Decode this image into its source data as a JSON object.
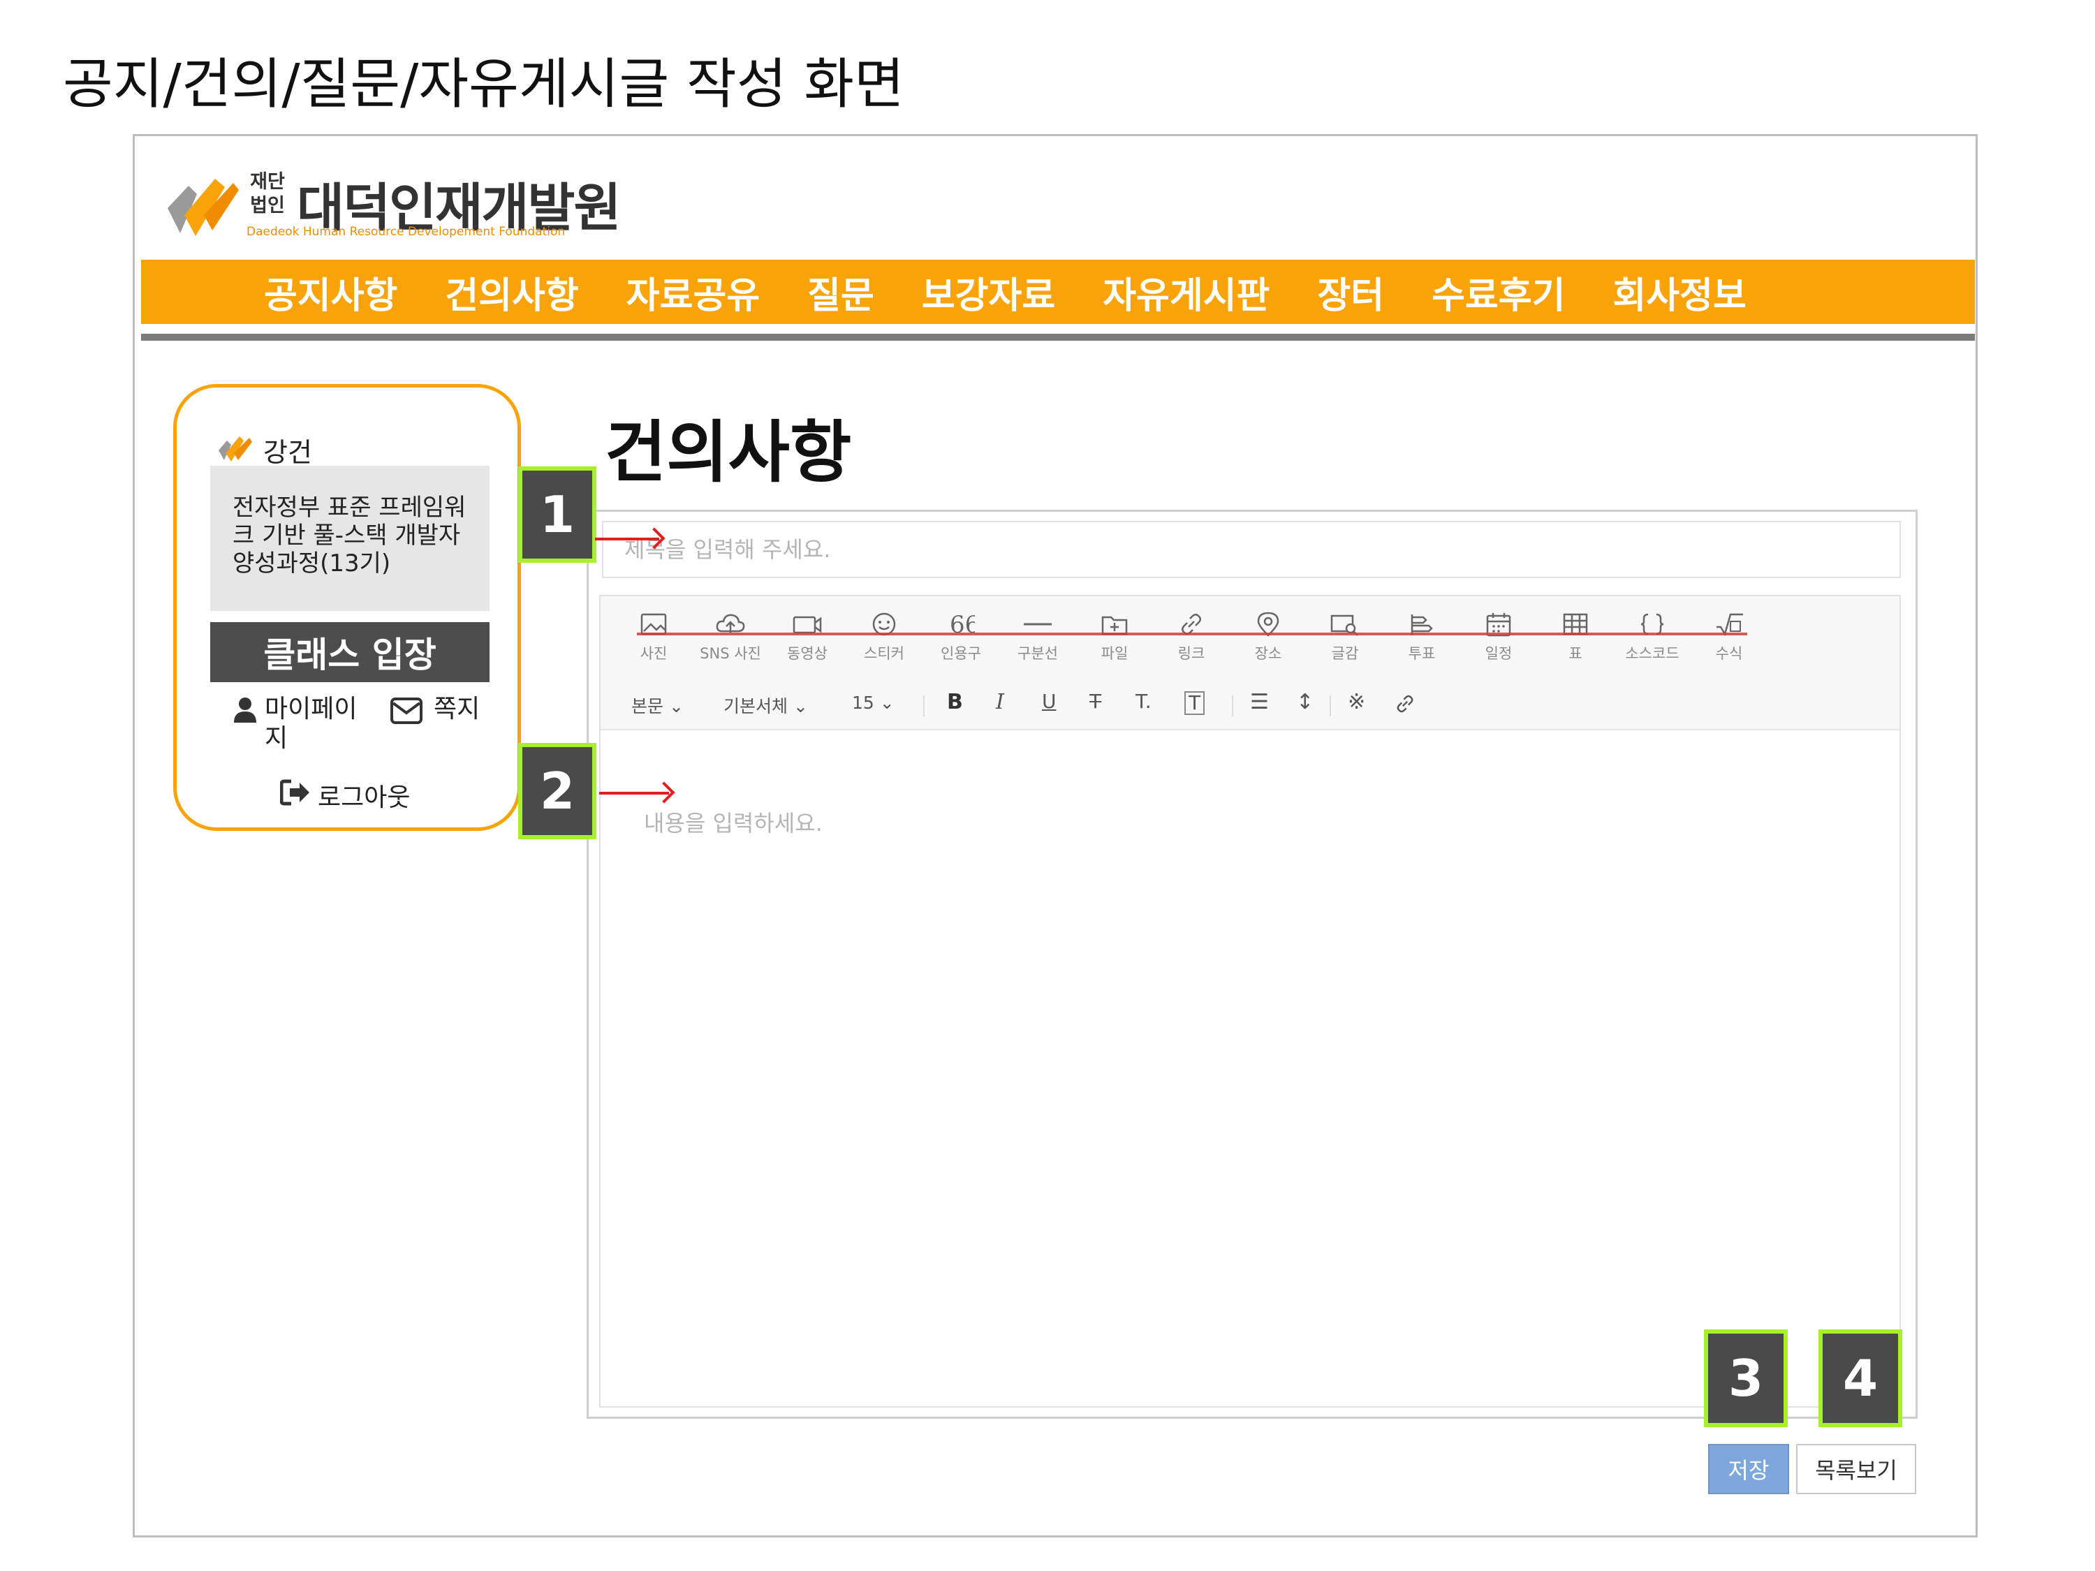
{
  "doc_title": "공지/건의/질문/자유게시글 작성 화면",
  "brand": {
    "corp_label": "재단법인",
    "name": "대덕인재개발원",
    "subtitle": "Daedeok Human Resource Developement Foundation"
  },
  "nav": [
    "공지사항",
    "건의사항",
    "자료공유",
    "질문",
    "보강자료",
    "자유게시판",
    "장터",
    "수료후기",
    "회사정보"
  ],
  "profile": {
    "username": "강건",
    "course": "전자정부 표준 프레임워크 기반 풀-스택 개발자 양성과정(13기)",
    "class_button": "클래스 입장",
    "mypage": "마이페이지",
    "messages": "쪽지",
    "logout": "로그아웃"
  },
  "board": {
    "title": "건의사항",
    "title_placeholder": "제목을 입력해 주세요.",
    "content_placeholder": "내용을 입력하세요."
  },
  "toolbar_primary": [
    "사진",
    "SNS 사진",
    "동영상",
    "스티커",
    "인용구",
    "구분선",
    "파일",
    "링크",
    "장소",
    "글감",
    "투표",
    "일정",
    "표",
    "소스코드",
    "수식"
  ],
  "toolbar_secondary": {
    "paragraph": "본문",
    "font": "기본서체",
    "size": "15",
    "bold": "B",
    "italic": "I",
    "underline": "U",
    "strike": "T",
    "subscript": "T.",
    "boxed": "T",
    "align": "☰",
    "line_height": "↕",
    "special_char": "※",
    "link": "🔗"
  },
  "buttons": {
    "save": "저장",
    "list": "목록보기"
  },
  "callouts": [
    "1",
    "2",
    "3",
    "4"
  ],
  "colors": {
    "accent": "#f9a30a",
    "nav_rule": "#7b7b7b",
    "callout_border": "#a6f12a",
    "arrow": "#e01f1f",
    "save_button": "#7ea7dc"
  }
}
